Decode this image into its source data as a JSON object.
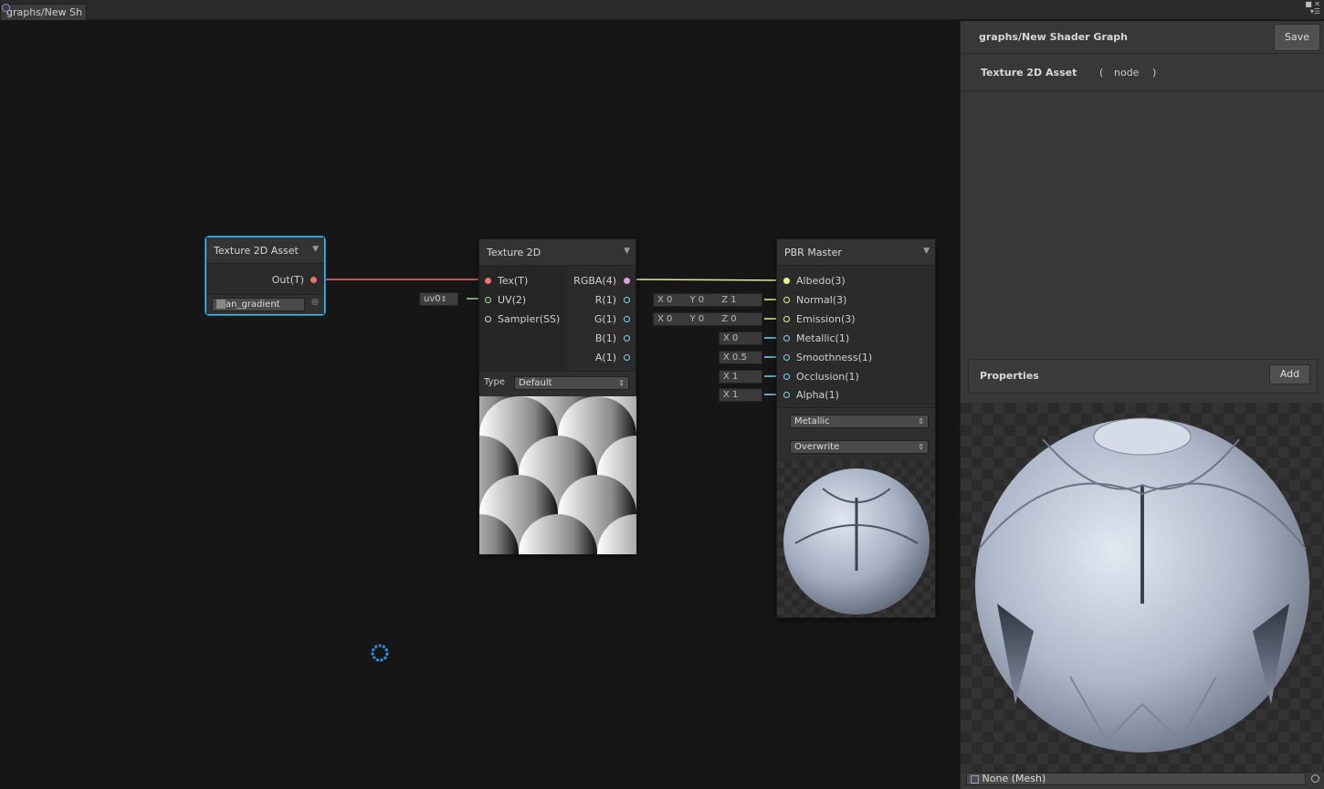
{
  "window": {
    "tab_label": "graphs/New Sh"
  },
  "colors": {
    "selection_outline": "#44c0f0",
    "texture_port": "#f07070",
    "vector4_port": "#e0a0e0",
    "vector3_port": "#f2f08c",
    "vector2_port": "#9be48c",
    "vector1_port": "#7dd8f0"
  },
  "icons": {
    "cursor": "busy-ring-icon",
    "chevron": "chevron-down-icon"
  },
  "nodes": {
    "texture_asset": {
      "title": "Texture 2D Asset",
      "out_label": "Out(T)",
      "asset_value": "an_gradient"
    },
    "texture_2d": {
      "title": "Texture 2D",
      "inputs": [
        "Tex(T)",
        "UV(2)",
        "Sampler(SS)"
      ],
      "outputs": [
        "RGBA(4)",
        "R(1)",
        "G(1)",
        "B(1)",
        "A(1)"
      ],
      "uv_value": "uv0",
      "type_label": "Type",
      "type_value": "Default"
    },
    "pbr_master": {
      "title": "PBR Master",
      "inputs": [
        "Albedo(3)",
        "Normal(3)",
        "Emission(3)",
        "Metallic(1)",
        "Smoothness(1)",
        "Occlusion(1)",
        "Alpha(1)"
      ],
      "normal_values": [
        "X 0",
        "Y 0",
        "Z 1"
      ],
      "emission_values": [
        "X 0",
        "Y 0",
        "Z 0"
      ],
      "metallic_value": "X 0",
      "smoothness_value": "X 0.5",
      "occlusion_value": "X 1",
      "alpha_value": "X 1",
      "workflow": "Metallic",
      "blend": "Overwrite"
    }
  },
  "inspector": {
    "title": "graphs/New Shader Graph",
    "save_label": "Save",
    "selected_node": "Texture 2D Asset",
    "open_paren": "(",
    "node_word": "node",
    "close_paren": ")",
    "properties_label": "Properties",
    "add_label": "Add",
    "mesh_value": "None (Mesh)"
  }
}
